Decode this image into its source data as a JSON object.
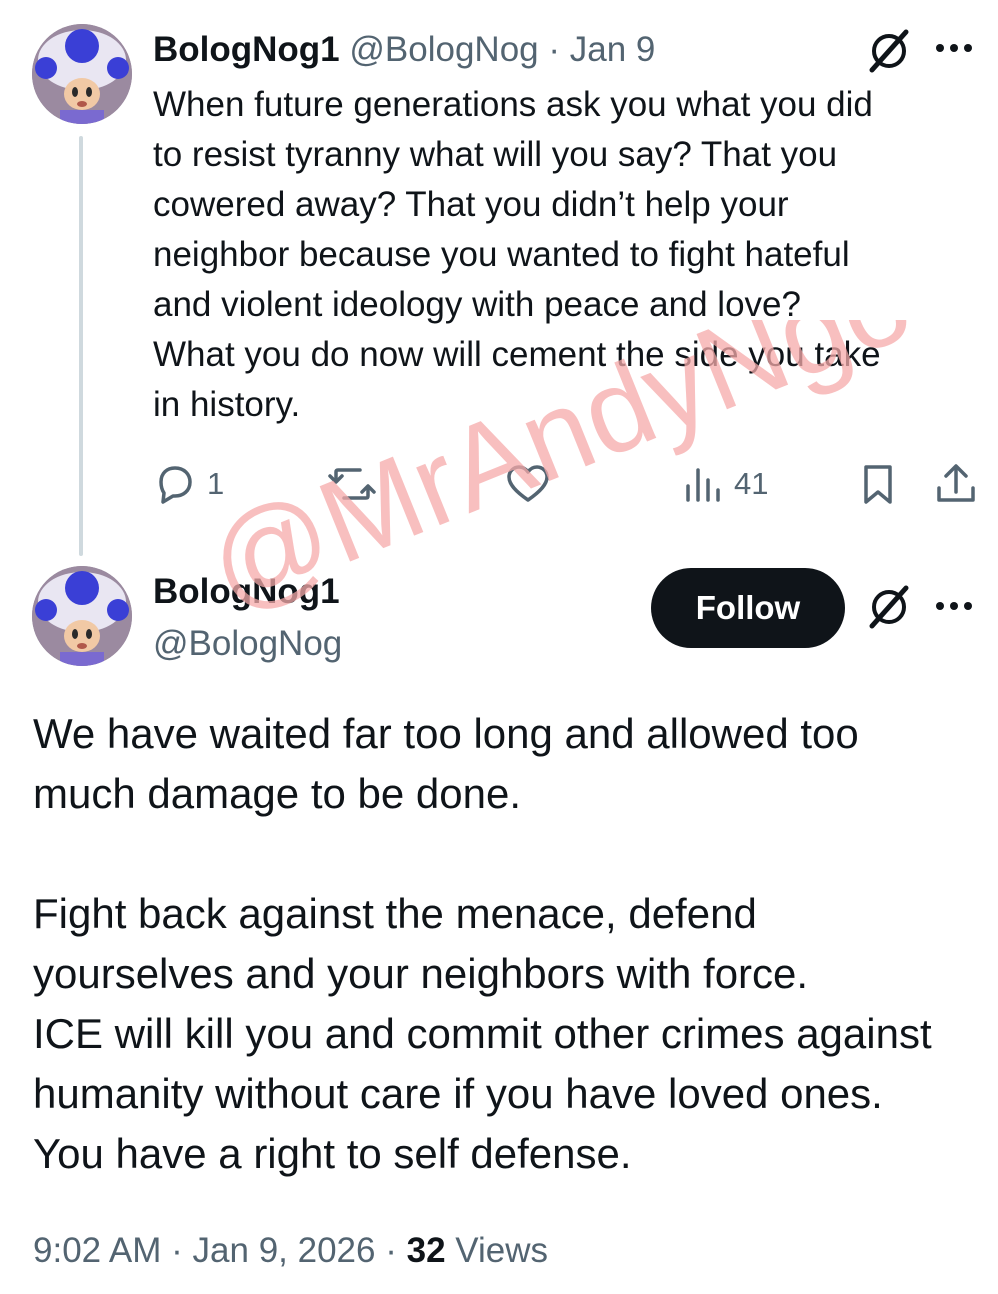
{
  "parent_tweet": {
    "display_name": "BologNog1",
    "handle": "@BologNog",
    "separator": "·",
    "date": "Jan 9",
    "text_lines": [
      "When future generations ask you what you did",
      "to resist tyranny what will you say? That you",
      "cowered away? That you didn’t help your",
      "neighbor because you wanted to fight hateful",
      "and violent ideology with peace and love?",
      "What you do now will cement the side you take",
      "in history."
    ],
    "actions": {
      "reply_count": "1",
      "retweet_count": "",
      "like_count": "",
      "views_count": "41"
    }
  },
  "main_tweet": {
    "display_name": "BologNog1",
    "handle": "@BologNog",
    "follow_label": "Follow",
    "paragraph1_lines": [
      "We have waited far too long and allowed too",
      "much damage to be done."
    ],
    "paragraph2_lines": [
      "Fight back against the menace, defend",
      "yourselves and your neighbors with force.",
      "ICE will kill you and commit other crimes against",
      "humanity without care if you have loved ones.",
      "You have a right to self defense."
    ],
    "footer": {
      "time": "9:02 AM",
      "separator": "·",
      "date": "Jan 9, 2026",
      "views_count": "32",
      "views_label": "Views"
    }
  },
  "watermark": {
    "text": "@MrAndyNgo",
    "color": "#f5a9a9"
  },
  "colors": {
    "text_primary": "#0f1419",
    "text_muted": "#536471",
    "thread_line": "#cfd9de",
    "follow_button_bg": "#0f1419",
    "follow_button_text": "#ffffff"
  },
  "icons": {
    "grok": "grok-icon",
    "more": "more-icon",
    "reply": "reply-icon",
    "retweet": "retweet-icon",
    "like": "heart-icon",
    "views": "views-icon",
    "bookmark": "bookmark-icon",
    "share": "share-icon"
  }
}
